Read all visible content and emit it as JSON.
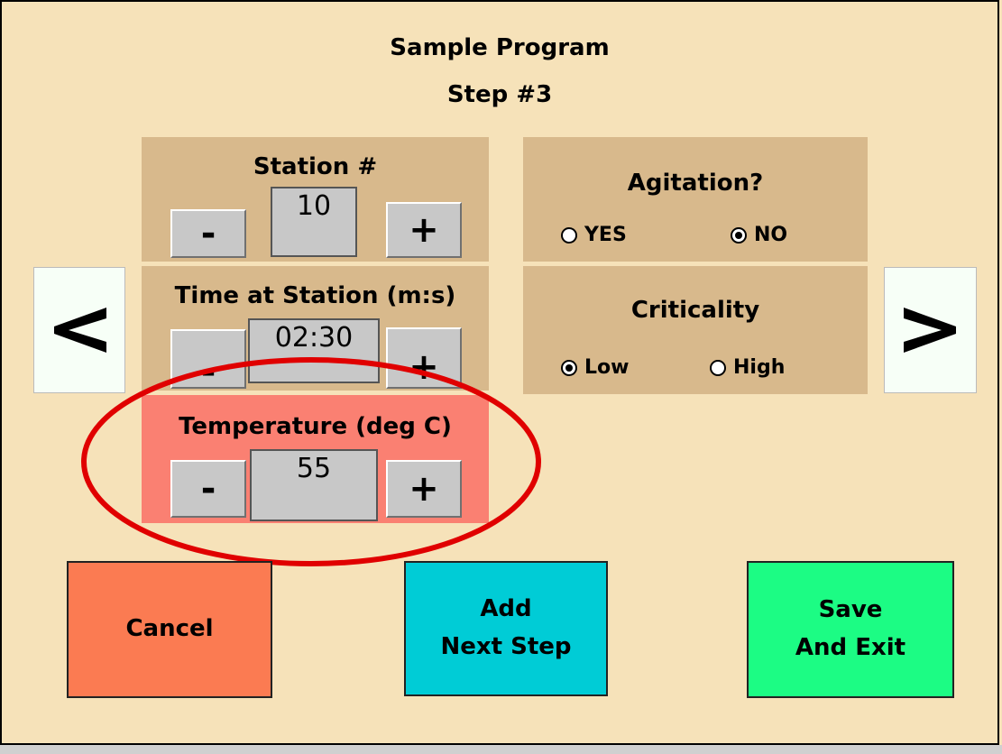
{
  "header": {
    "title": "Sample Program",
    "step": "Step #3"
  },
  "station": {
    "label": "Station #",
    "value": "10",
    "minus": "-",
    "plus": "+"
  },
  "time": {
    "label": "Time at Station (m:s)",
    "value": "02:30",
    "minus": "-",
    "plus": "+"
  },
  "temperature": {
    "label": "Temperature (deg C)",
    "value": "55",
    "minus": "-",
    "plus": "+"
  },
  "agitation": {
    "label": "Agitation?",
    "options": [
      {
        "label": "YES",
        "selected": false
      },
      {
        "label": "NO",
        "selected": true
      }
    ]
  },
  "criticality": {
    "label": "Criticality",
    "options": [
      {
        "label": "Low",
        "selected": true
      },
      {
        "label": "High",
        "selected": false
      }
    ]
  },
  "nav": {
    "prev": "<",
    "next": ">"
  },
  "actions": {
    "cancel": {
      "label": "Cancel",
      "color": "#fb7b52"
    },
    "add_next": {
      "line1": "Add",
      "line2": "Next Step",
      "color": "#00ccd6"
    },
    "save_exit": {
      "line1": "Save",
      "line2": "And Exit",
      "color": "#1cfc84"
    }
  },
  "colors": {
    "background": "#f6e2b9",
    "panel": "#d8b98c",
    "highlight_panel": "#fa8072",
    "highlight_ring": "#e00000"
  }
}
